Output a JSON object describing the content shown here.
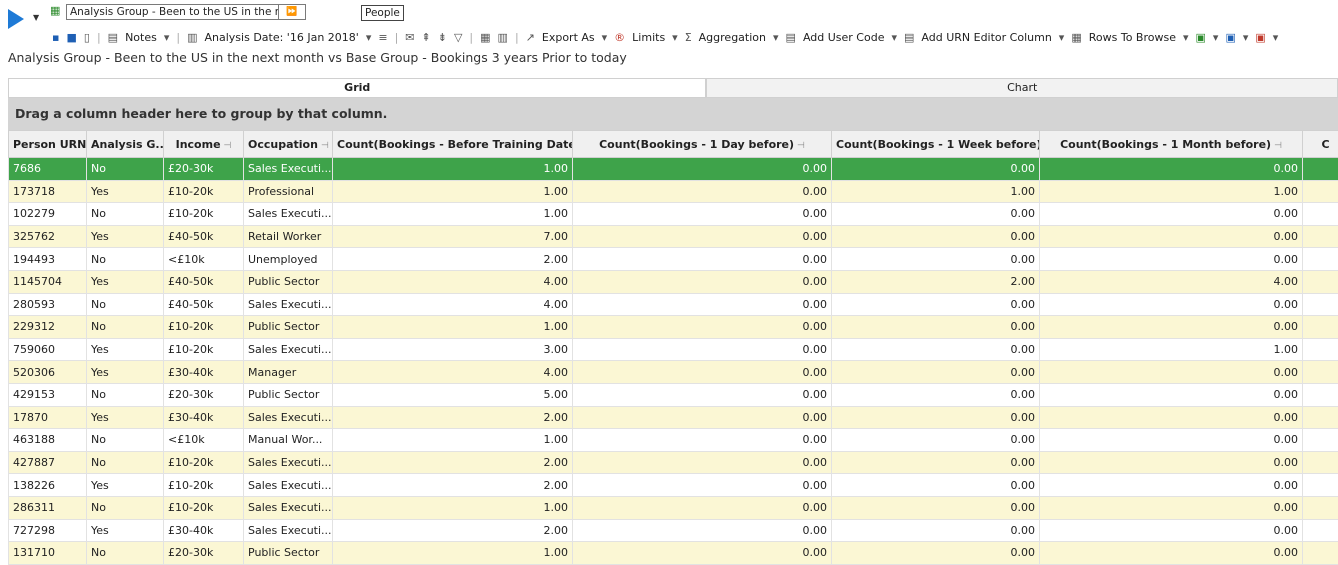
{
  "toolbar": {
    "analysis_selector_value": "Analysis Group - Been to the US in the next mo",
    "analysis_selector_button": "⏩",
    "people_label": "People",
    "notes_label": "Notes",
    "analysis_date_label": "Analysis Date: '16 Jan 2018'",
    "export_label": "Export As",
    "limits_label": "Limits",
    "aggregation_label": "Aggregation",
    "add_user_code_label": "Add User Code",
    "add_urn_label": "Add URN Editor Column",
    "rows_to_browse_label": "Rows To Browse"
  },
  "subtitle": "Analysis Group - Been to the US in the next month vs Base Group - Bookings 3 years Prior to today",
  "tabs": [
    {
      "label": "Grid"
    },
    {
      "label": "Chart"
    }
  ],
  "group_hint": "Drag a column header here to group by that column.",
  "columns": [
    "Person URN",
    "Analysis G...",
    "Income",
    "Occupation",
    "Count(Bookings - Before Training Date)",
    "Count(Bookings - 1 Day before)",
    "Count(Bookings - 1 Week before)",
    "Count(Bookings - 1 Month before)",
    "C"
  ],
  "rows": [
    [
      "7686",
      "No",
      "£20-30k",
      "Sales Executi...",
      "1.00",
      "0.00",
      "0.00",
      "0.00"
    ],
    [
      "173718",
      "Yes",
      "£10-20k",
      "Professional",
      "1.00",
      "0.00",
      "1.00",
      "1.00"
    ],
    [
      "102279",
      "No",
      "£10-20k",
      "Sales Executi...",
      "1.00",
      "0.00",
      "0.00",
      "0.00"
    ],
    [
      "325762",
      "Yes",
      "£40-50k",
      "Retail Worker",
      "7.00",
      "0.00",
      "0.00",
      "0.00"
    ],
    [
      "194493",
      "No",
      "<£10k",
      "Unemployed",
      "2.00",
      "0.00",
      "0.00",
      "0.00"
    ],
    [
      "1145704",
      "Yes",
      "£40-50k",
      "Public Sector",
      "4.00",
      "0.00",
      "2.00",
      "4.00"
    ],
    [
      "280593",
      "No",
      "£40-50k",
      "Sales Executi...",
      "4.00",
      "0.00",
      "0.00",
      "0.00"
    ],
    [
      "229312",
      "No",
      "£10-20k",
      "Public Sector",
      "1.00",
      "0.00",
      "0.00",
      "0.00"
    ],
    [
      "759060",
      "Yes",
      "£10-20k",
      "Sales Executi...",
      "3.00",
      "0.00",
      "0.00",
      "1.00"
    ],
    [
      "520306",
      "Yes",
      "£30-40k",
      "Manager",
      "4.00",
      "0.00",
      "0.00",
      "0.00"
    ],
    [
      "429153",
      "No",
      "£20-30k",
      "Public Sector",
      "5.00",
      "0.00",
      "0.00",
      "0.00"
    ],
    [
      "17870",
      "Yes",
      "£30-40k",
      "Sales Executi...",
      "2.00",
      "0.00",
      "0.00",
      "0.00"
    ],
    [
      "463188",
      "No",
      "<£10k",
      "Manual Wor...",
      "1.00",
      "0.00",
      "0.00",
      "0.00"
    ],
    [
      "427887",
      "No",
      "£10-20k",
      "Sales Executi...",
      "2.00",
      "0.00",
      "0.00",
      "0.00"
    ],
    [
      "138226",
      "Yes",
      "£10-20k",
      "Sales Executi...",
      "2.00",
      "0.00",
      "0.00",
      "0.00"
    ],
    [
      "286311",
      "No",
      "£10-20k",
      "Sales Executi...",
      "1.00",
      "0.00",
      "0.00",
      "0.00"
    ],
    [
      "727298",
      "Yes",
      "£30-40k",
      "Sales Executi...",
      "2.00",
      "0.00",
      "0.00",
      "0.00"
    ],
    [
      "131710",
      "No",
      "£20-30k",
      "Public Sector",
      "1.00",
      "0.00",
      "0.00",
      "0.00"
    ]
  ],
  "colors": {
    "selected_row": "#3ea34a",
    "alt_row": "#fbf7d4",
    "accent": "#1e7ad6"
  }
}
